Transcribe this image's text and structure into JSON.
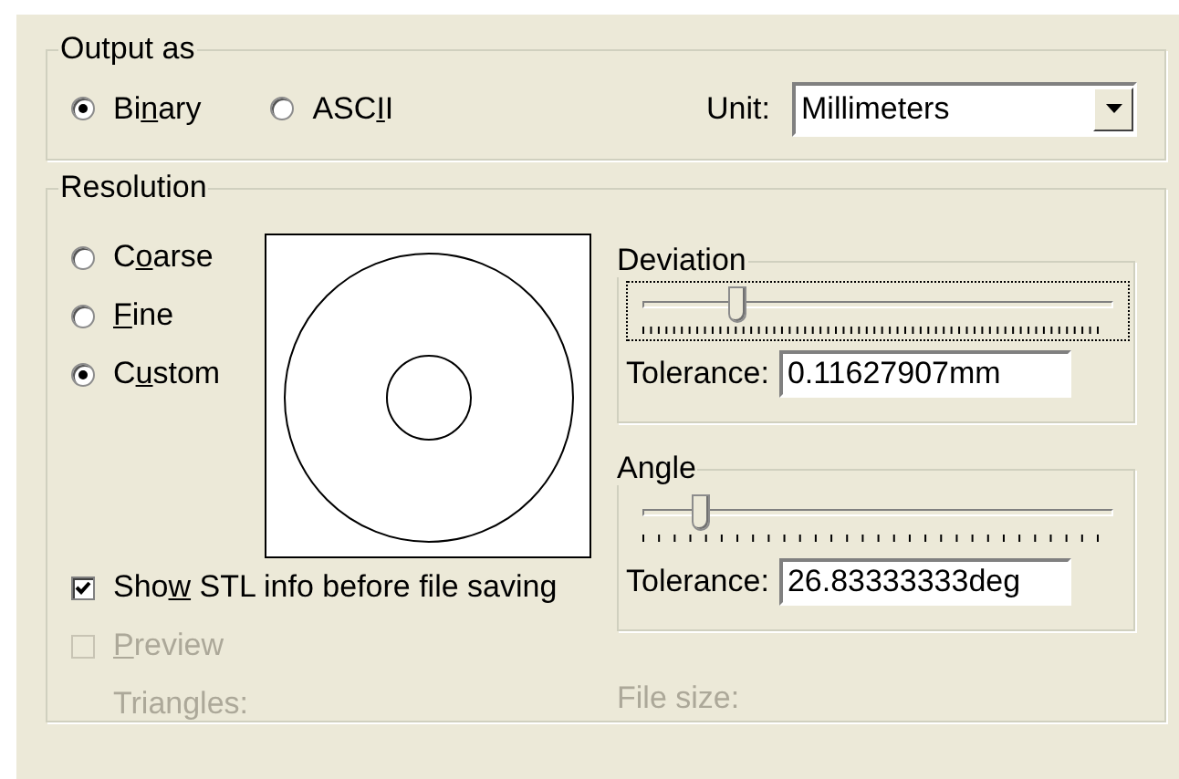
{
  "output_as": {
    "title": "Output as",
    "formats": [
      {
        "label_before": "Bi",
        "access_key": "n",
        "label_after": "ary",
        "selected": true
      },
      {
        "label_before": "ASC",
        "access_key": "I",
        "label_after": "I",
        "selected": false
      }
    ],
    "unit": {
      "label": "Unit:",
      "value": "Millimeters"
    }
  },
  "resolution": {
    "title": "Resolution",
    "options": [
      {
        "label_before": "C",
        "access_key": "o",
        "label_after": "arse",
        "selected": false
      },
      {
        "access_key": "F",
        "label_after": "ine",
        "selected": false
      },
      {
        "label_before": "C",
        "access_key": "u",
        "label_after": "stom",
        "selected": true
      }
    ],
    "deviation": {
      "title": "Deviation",
      "level": 0.2,
      "focused": true,
      "tolerance_label": "Tolerance:",
      "tolerance": "0.11627907mm"
    },
    "angle": {
      "title": "Angle",
      "level": 0.12,
      "focused": false,
      "tolerance_label": "Tolerance:",
      "tolerance": "26.83333333deg"
    },
    "show_info": {
      "label_before": "Sho",
      "access_key": "w",
      "label_after": " STL info before file saving",
      "checked": true,
      "disabled": false
    },
    "preview": {
      "access_key": "P",
      "label_after": "review",
      "checked": false,
      "disabled": true
    },
    "triangles_label": "Triangles:",
    "file_size_label": "File size:"
  }
}
